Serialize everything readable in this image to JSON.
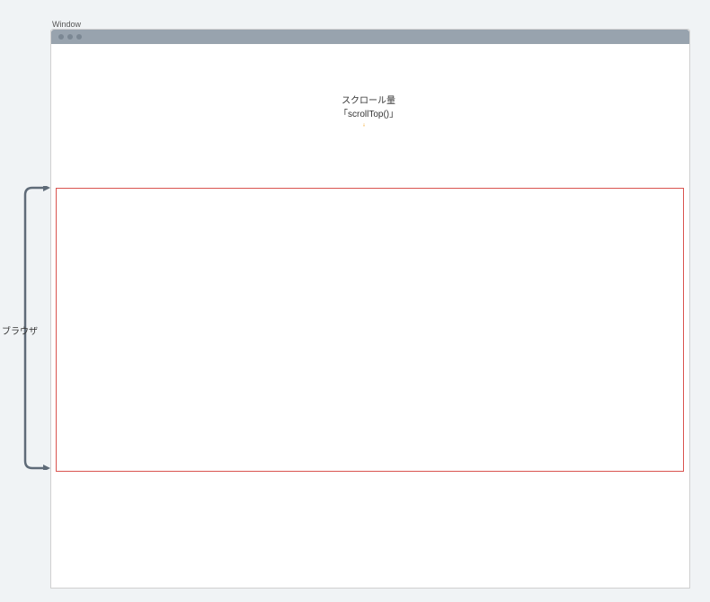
{
  "window": {
    "label": "Window"
  },
  "scroll": {
    "label_line1": "スクロール量",
    "label_line2": "「scrollTop()」"
  },
  "browser": {
    "label": "ブラウザ"
  },
  "colors": {
    "background": "#f0f3f5",
    "titlebar": "#98a3ae",
    "arrow": "#f5a623",
    "viewport_border": "#d9534f",
    "bracket": "#5f6b78"
  }
}
